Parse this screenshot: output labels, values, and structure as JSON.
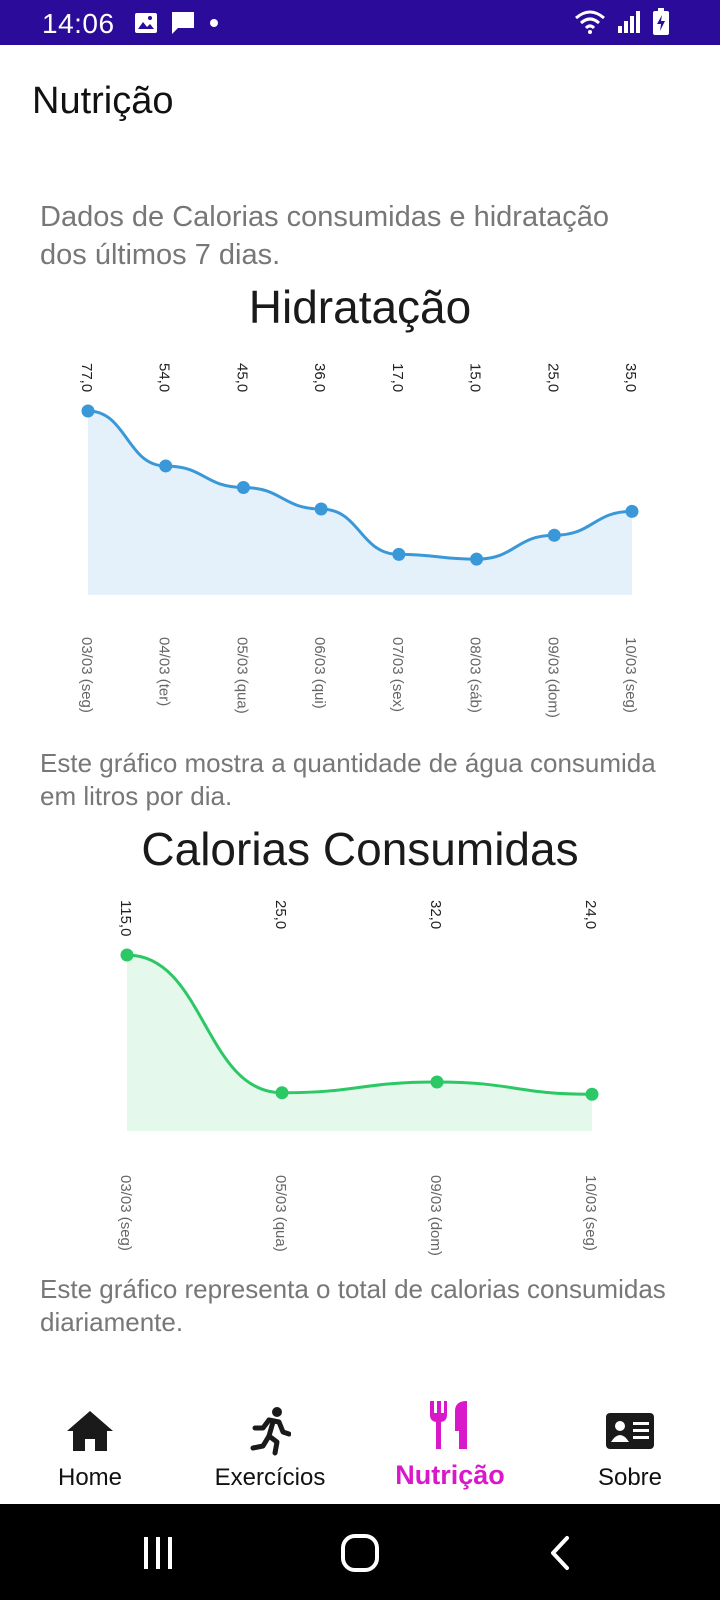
{
  "status": {
    "time": "14:06",
    "left_icons": [
      "image-icon",
      "message-icon",
      "dot-icon"
    ],
    "right_icons": [
      "wifi-icon",
      "signal-icon",
      "battery-charging-icon"
    ],
    "bar_color": "#2a0b9a"
  },
  "appbar": {
    "title": "Nutrição"
  },
  "intro_text": "Dados de Calorias consumidas e hidratação dos últimos 7 dias.",
  "hydration": {
    "title": "Hidratação",
    "caption": "Este gráfico mostra a quantidade de água consumida em litros por dia."
  },
  "calories": {
    "title": "Calorias Consumidas",
    "caption": "Este gráfico representa o total de calorias consumidas diariamente."
  },
  "chart_data": [
    {
      "type": "area",
      "title": "Hidratação",
      "color": "#3a98d8",
      "fill": "#e4f0fa",
      "categories": [
        "03/03 (seg)",
        "04/03 (ter)",
        "05/03 (qua)",
        "06/03 (qui)",
        "07/03 (sex)",
        "08/03 (sáb)",
        "09/03 (dom)",
        "10/03 (seg)"
      ],
      "values": [
        77.0,
        54.0,
        45.0,
        36.0,
        17.0,
        15.0,
        25.0,
        35.0
      ],
      "value_labels": [
        "77,0",
        "54,0",
        "45,0",
        "36,0",
        "17,0",
        "15,0",
        "25,0",
        "35,0"
      ],
      "ylim": [
        0,
        77
      ]
    },
    {
      "type": "area",
      "title": "Calorias Consumidas",
      "color": "#2cc866",
      "fill": "#e5f8ec",
      "categories": [
        "03/03 (seg)",
        "05/03 (qua)",
        "09/03 (dom)",
        "10/03 (seg)"
      ],
      "values": [
        115.0,
        25.0,
        32.0,
        24.0
      ],
      "value_labels": [
        "115,0",
        "25,0",
        "32,0",
        "24,0"
      ],
      "ylim": [
        0,
        115
      ]
    }
  ],
  "nav": {
    "active_color": "#d918c9",
    "items": [
      {
        "label": "Home",
        "icon": "home-icon"
      },
      {
        "label": "Exercícios",
        "icon": "running-icon"
      },
      {
        "label": "Nutrição",
        "icon": "utensils-icon"
      },
      {
        "label": "Sobre",
        "icon": "id-card-icon"
      }
    ]
  },
  "system_nav": [
    "recents-icon",
    "home-circle-icon",
    "back-icon"
  ]
}
